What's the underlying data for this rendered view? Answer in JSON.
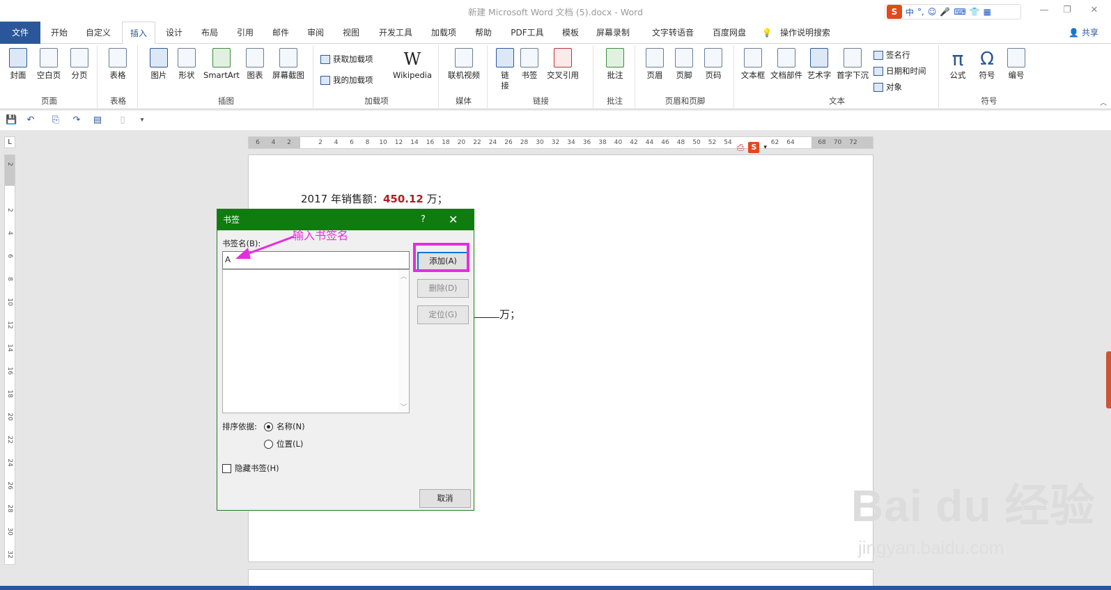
{
  "window": {
    "title": "新建 Microsoft Word 文档 (5).docx  -  Word"
  },
  "ime": {
    "logo": "S",
    "items": [
      "中",
      "°,",
      "☺",
      "🎤",
      "⌨",
      "👕",
      "▦"
    ]
  },
  "tabs": {
    "file": "文件",
    "items": [
      "开始",
      "自定义",
      "插入",
      "设计",
      "布局",
      "引用",
      "邮件",
      "审阅",
      "视图",
      "开发工具",
      "加载项",
      "帮助",
      "PDF工具",
      "模板",
      "屏幕录制",
      "文字转语音",
      "百度网盘"
    ],
    "active": "插入",
    "tell_me": "操作说明搜索",
    "share": "共享"
  },
  "ribbon": {
    "pages": {
      "label": "页面",
      "cover": "封面",
      "blank": "空白页",
      "break": "分页"
    },
    "tables": {
      "label": "表格",
      "table": "表格"
    },
    "illustrations": {
      "label": "插图",
      "picture": "图片",
      "shapes": "形状",
      "smartart": "SmartArt",
      "chart": "图表",
      "screenshot": "屏幕截图"
    },
    "addins": {
      "label": "加载项",
      "get": "获取加载项",
      "my": "我的加载项",
      "wikipedia": "Wikipedia"
    },
    "media": {
      "label": "媒体",
      "video": "联机视频"
    },
    "links": {
      "label": "链接",
      "link": "链接",
      "bookmark": "书签",
      "crossref": "交叉引用"
    },
    "comments": {
      "label": "批注",
      "comment": "批注"
    },
    "headerfooter": {
      "label": "页眉和页脚",
      "header": "页眉",
      "footer": "页脚",
      "pagenum": "页码"
    },
    "text": {
      "label": "文本",
      "textbox": "文本框",
      "quickparts": "文档部件",
      "wordart": "艺术字",
      "dropcap": "首字下沉",
      "sigline": "签名行",
      "datetime": "日期和时间",
      "object": "对象"
    },
    "symbols": {
      "label": "符号",
      "equation": "公式",
      "symbol": "符号",
      "number": "编号"
    }
  },
  "ruler": {
    "h_ticks": [
      "6",
      "4",
      "2",
      "",
      "2",
      "4",
      "6",
      "8",
      "10",
      "12",
      "14",
      "16",
      "18",
      "20",
      "22",
      "24",
      "26",
      "28",
      "30",
      "32",
      "34",
      "36",
      "38",
      "40",
      "42",
      "44",
      "46",
      "48",
      "50",
      "52",
      "54",
      "",
      "",
      "62",
      "64",
      "",
      "68",
      "70",
      "72"
    ],
    "v_ticks": [
      "2",
      "",
      "2",
      "4",
      "6",
      "8",
      "10",
      "12",
      "14",
      "16",
      "18",
      "20",
      "22",
      "24",
      "26",
      "28",
      "30",
      "32"
    ]
  },
  "document": {
    "line1_prefix": "2017 年销售额：",
    "line1_value": "450.12",
    "line1_suffix": " 万；",
    "blank_suffix": "万；"
  },
  "dialog": {
    "title": "书签",
    "help": "?",
    "close": "✕",
    "name_label": "书签名(B):",
    "name_value": "A",
    "add": "添加(A)",
    "delete": "删除(D)",
    "goto": "定位(G)",
    "sort_label": "排序依据:",
    "sort_name": "名称(N)",
    "sort_location": "位置(L)",
    "hidden": "隐藏书签(H)",
    "cancel": "取消"
  },
  "annotation": {
    "text": "输入书签名",
    "color": "#e62ce0"
  },
  "watermark": {
    "big": "Bai du 经验",
    "small": "jingyan.baidu.com"
  },
  "colors": {
    "accent": "#2b579a",
    "dialog_title": "#107c10",
    "highlight": "#e62ce0",
    "value_red": "#b01e24"
  }
}
